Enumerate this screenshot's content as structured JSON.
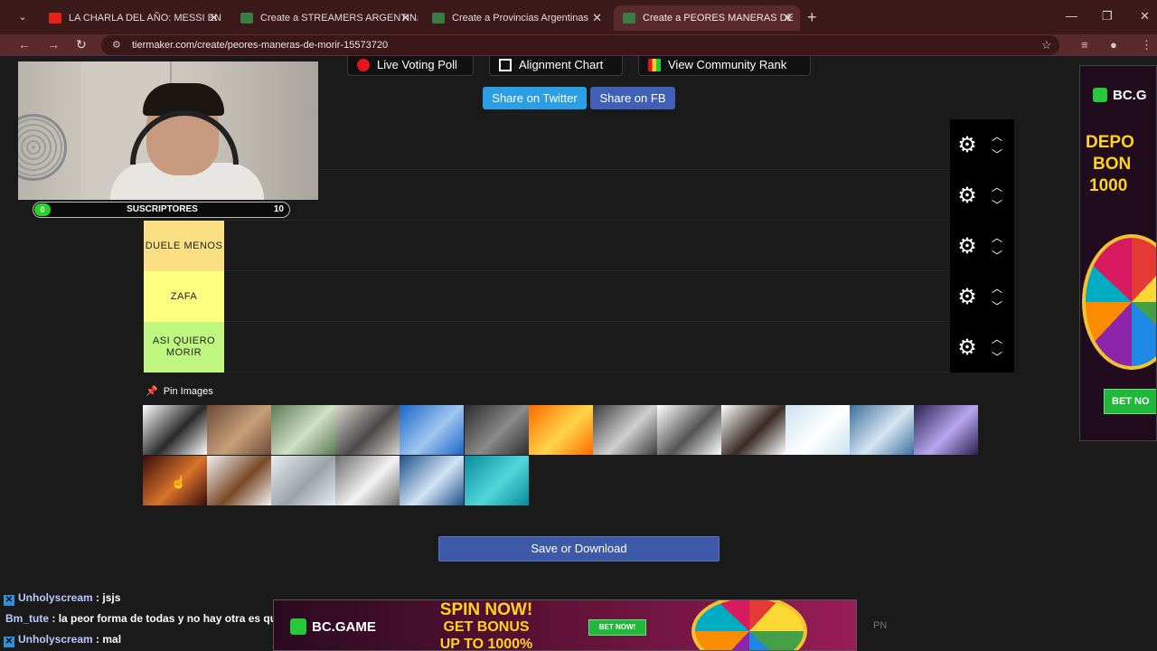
{
  "browser": {
    "tabs": [
      {
        "title": "LA CHARLA DEL AÑO: MESSI EN",
        "favicon_color": "#e62117"
      },
      {
        "title": "Create a STREAMERS ARGENTINA",
        "favicon_color": "#3a7d44"
      },
      {
        "title": "Create a Provincias Argentinas",
        "favicon_color": "#3a7d44"
      },
      {
        "title": "Create a PEORES MANERAS DE",
        "favicon_color": "#3a7d44"
      }
    ],
    "active_tab": 3,
    "url": "tiermaker.com/create/peores-maneras-de-morir-15573720"
  },
  "toolbar": {
    "live_voting": "Live Voting Poll",
    "alignment_chart": "Alignment Chart",
    "community_rank": "View Community Rank"
  },
  "share": {
    "twitter": "Share on Twitter",
    "fb": "Share on FB"
  },
  "overlay": {
    "subs_label": "SUSCRIPTORES",
    "subs_current": "0",
    "subs_goal": "10"
  },
  "tiers": [
    {
      "label": "",
      "color": "#1a1a1a"
    },
    {
      "label": "",
      "color": "#1a1a1a"
    },
    {
      "label": "DUELE MENOS",
      "color": "#fbe083"
    },
    {
      "label": "ZAFA",
      "color": "#fdfd80"
    },
    {
      "label": "ASI QUIERO MORIR",
      "color": "#bff780"
    }
  ],
  "pin_images_label": "Pin Images",
  "images": [
    {
      "name": "gun",
      "colors": [
        "#ffffff",
        "#2a2a2a"
      ]
    },
    {
      "name": "abandoned-hall",
      "colors": [
        "#6b4a36",
        "#c7a07a"
      ]
    },
    {
      "name": "green-vortex",
      "colors": [
        "#5c7a54",
        "#cfe0c4"
      ]
    },
    {
      "name": "etching",
      "colors": [
        "#d8d4cc",
        "#4a4a4a"
      ]
    },
    {
      "name": "water-bottle",
      "colors": [
        "#1b64c8",
        "#9fc6f0"
      ]
    },
    {
      "name": "boiling-pot",
      "colors": [
        "#2c2c2c",
        "#8a8a8a"
      ]
    },
    {
      "name": "fire",
      "colors": [
        "#ff6a00",
        "#ffd54a"
      ]
    },
    {
      "name": "car-crash",
      "colors": [
        "#3d3d3d",
        "#cfcfcf"
      ]
    },
    {
      "name": "knife",
      "colors": [
        "#ffffff",
        "#555555"
      ]
    },
    {
      "name": "whip",
      "colors": [
        "#ffffff",
        "#3a2a24"
      ]
    },
    {
      "name": "ice-cubes",
      "colors": [
        "#c8e2f0",
        "#ffffff"
      ]
    },
    {
      "name": "shark",
      "colors": [
        "#3c6f9c",
        "#d6e6f2"
      ]
    },
    {
      "name": "lightning",
      "colors": [
        "#2a2250",
        "#b7a6ef"
      ]
    },
    {
      "name": "bed",
      "colors": [
        "#3a0d0a",
        "#d8742b"
      ]
    },
    {
      "name": "bear",
      "colors": [
        "#f2f2f2",
        "#7a4a28"
      ]
    },
    {
      "name": "snow-forest",
      "colors": [
        "#e8ecef",
        "#9aa3a8"
      ]
    },
    {
      "name": "plate",
      "colors": [
        "#6c6c6c",
        "#f4f4f4"
      ]
    },
    {
      "name": "skyscraper",
      "colors": [
        "#1c4f88",
        "#d2e4f5"
      ]
    },
    {
      "name": "turquoise-water",
      "colors": [
        "#0b8a9a",
        "#4fd6da"
      ]
    }
  ],
  "save_button": "Save or Download",
  "chat": [
    {
      "user": "Unholyscream",
      "message": "jsjs",
      "user_color": "#b9c9ff"
    },
    {
      "user": "Bm_tute",
      "message": "la peor forma de todas y no hay otra es quemado",
      "user_color": "#b9c9ff"
    },
    {
      "user": "Unholyscream",
      "message": "mal",
      "user_color": "#b9c9ff"
    }
  ],
  "ad_right": {
    "brand": "BC.G",
    "line1": "DEPO",
    "line2": "BON",
    "line3": "1000",
    "bet": "BET NO"
  },
  "ad_bottom": {
    "brand": "BC.GAME",
    "l1": "SPIN NOW!",
    "l2": "GET BONUS",
    "l3": "UP TO 1000%",
    "bet": "BET NOW!"
  },
  "pn_label": "PN"
}
